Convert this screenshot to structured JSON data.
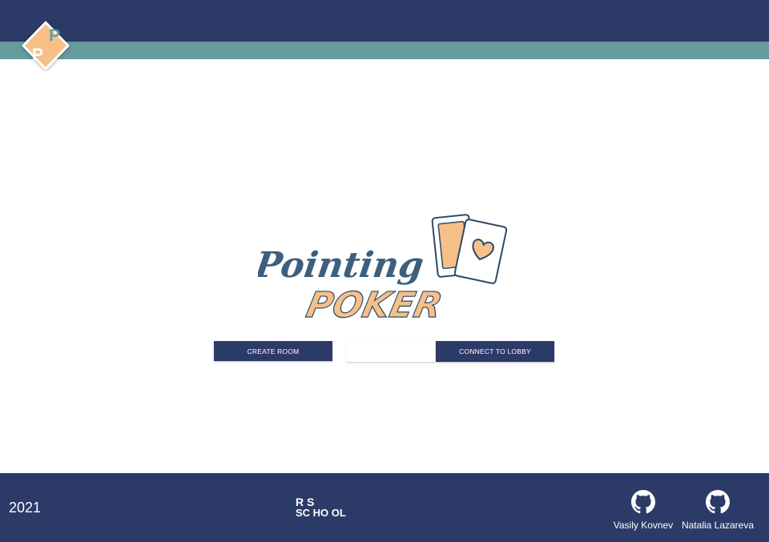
{
  "header": {
    "logo_letters": [
      "P",
      "P"
    ],
    "colors": {
      "dark": "#2c3a67",
      "stripe": "#669c9d",
      "accent": "#f6c088"
    }
  },
  "main": {
    "logo": {
      "word1": "Pointing",
      "word2": "POKER"
    },
    "create_room_label": "CREATE ROOM",
    "lobby_input": {
      "value": "",
      "placeholder": ""
    },
    "connect_label": "CONNECT TO LOBBY"
  },
  "footer": {
    "year": "2021",
    "school_logo": {
      "top": "R  S",
      "bottom": "SC HO OL"
    },
    "developers": [
      {
        "name": "Vasily Kovnev",
        "icon": "github-icon"
      },
      {
        "name": "Natalia Lazareva",
        "icon": "github-icon"
      }
    ]
  }
}
